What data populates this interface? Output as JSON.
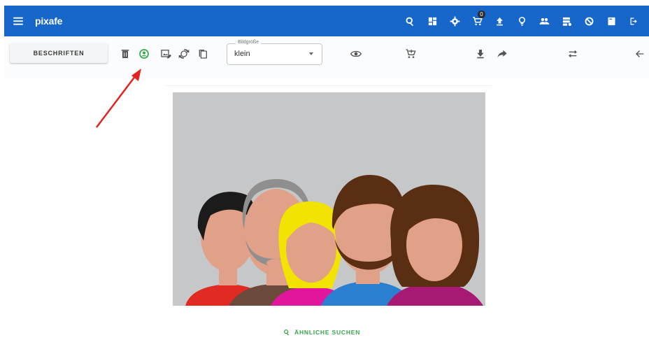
{
  "app": {
    "brand": "pixafe"
  },
  "appbar": {
    "icons": [
      "menu-icon",
      "search-icon",
      "dashboard-icon",
      "gear-icon",
      "cart-icon",
      "upload-icon",
      "bulb-icon",
      "group-icon",
      "storage-icon",
      "block-icon",
      "book-icon",
      "logout-icon"
    ],
    "cart_badge": "0"
  },
  "toolbar": {
    "beschriften_label": "BESCHRIFTEN",
    "size_select": {
      "legend": "Bildgröße",
      "value": "klein"
    }
  },
  "content": {
    "similar_label": "ÄHNLICHE SUCHEN"
  },
  "colors": {
    "appbar": "#1766c9",
    "accent_green": "#35a64b",
    "annotation_red": "#e32322",
    "image_bg": "#c6c7c9"
  }
}
